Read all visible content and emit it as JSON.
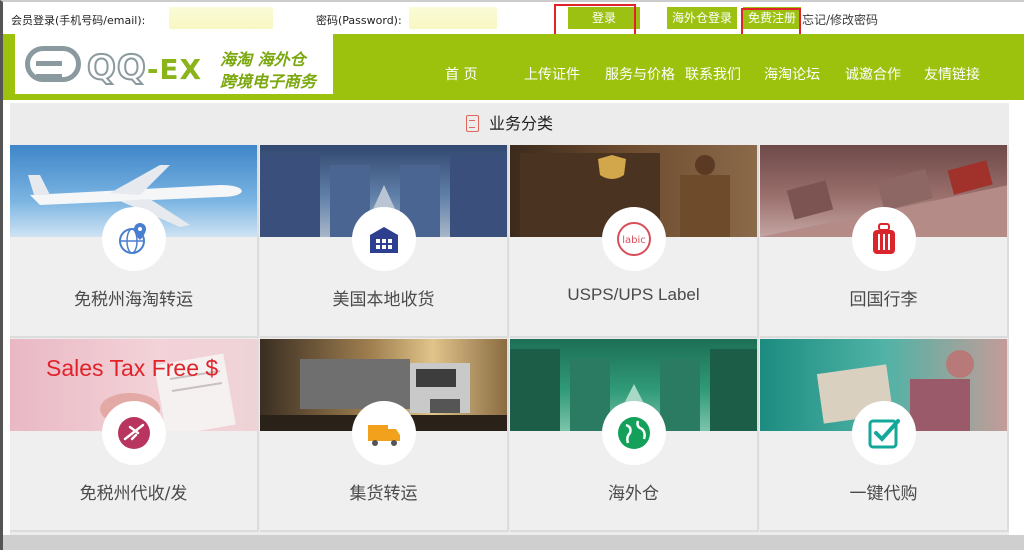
{
  "login": {
    "member_label": "会员登录(手机号码/email):",
    "password_label": "密码(Password):",
    "login_button": "登录",
    "warehouse_login": "海外仓登录",
    "register_link": "免费注册",
    "forgot_link": "忘记/修改密码"
  },
  "brand": {
    "name_main": "QQ",
    "name_ex": "-EX",
    "slogan_line1": "海淘   海外仓",
    "slogan_line2": "跨境电子商务"
  },
  "nav": [
    "首  页",
    "上传证件",
    "服务与价格",
    "联系我们",
    "海淘论坛",
    "诚邀合作",
    "友情链接"
  ],
  "section": {
    "title": "业务分类",
    "icon": "document-icon"
  },
  "cards": [
    {
      "label": "免税州海淘转运",
      "icon": "globe-pin-icon"
    },
    {
      "label": "美国本地收货",
      "icon": "warehouse-icon"
    },
    {
      "label": "USPS/UPS Label",
      "icon": "label-badge-icon",
      "badge_text": "labic"
    },
    {
      "label": "回国行李",
      "icon": "suitcase-icon"
    },
    {
      "label": "免税州代收/发",
      "icon": "airplane-icon",
      "overlay_text": "Sales Tax Free $"
    },
    {
      "label": "集货转运",
      "icon": "truck-icon"
    },
    {
      "label": "海外仓",
      "icon": "globe-icon"
    },
    {
      "label": "一键代购",
      "icon": "checkbox-icon"
    }
  ],
  "colors": {
    "accent": "#9cc20e",
    "red": "#e0232a",
    "icon_blue": "#4a7fcf",
    "icon_red": "#d9262d",
    "icon_green": "#12a05a",
    "icon_orange": "#f1a11b"
  }
}
